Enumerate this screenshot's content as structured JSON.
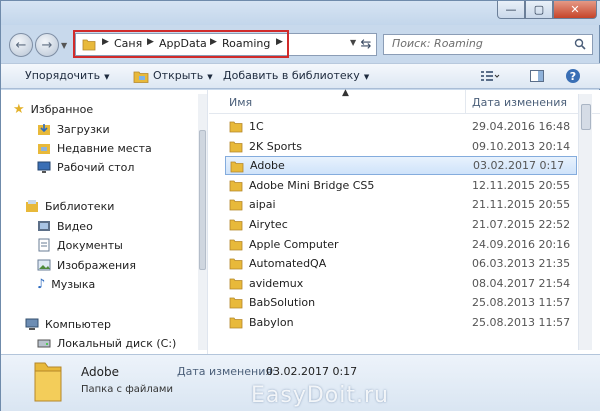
{
  "window": {
    "caption": {
      "minimize_glyph": "—",
      "maximize_glyph": "▢",
      "close_glyph": "✕"
    }
  },
  "address": {
    "crumbs": [
      "Саня",
      "AppData",
      "Roaming"
    ],
    "search_placeholder": "Поиск: Roaming"
  },
  "toolbar": {
    "organize": "Упорядочить",
    "open": "Открыть",
    "add_library": "Добавить в библиотеку"
  },
  "navigation": {
    "favorites": "Избранное",
    "downloads": "Загрузки",
    "recent": "Недавние места",
    "desktop": "Рабочий стол",
    "libraries": "Библиотеки",
    "video": "Видео",
    "documents": "Документы",
    "pictures": "Изображения",
    "music": "Музыка",
    "computer": "Компьютер",
    "local_disk": "Локальный диск (C:)"
  },
  "columns": {
    "name": "Имя",
    "date": "Дата изменения"
  },
  "files": [
    {
      "name": "1C",
      "date": "29.04.2016 16:48"
    },
    {
      "name": "2K Sports",
      "date": "09.10.2013 20:14"
    },
    {
      "name": "Adobe",
      "date": "03.02.2017 0:17"
    },
    {
      "name": "Adobe Mini Bridge CS5",
      "date": "12.11.2015 20:55"
    },
    {
      "name": "aipai",
      "date": "21.11.2015 20:55"
    },
    {
      "name": "Airytec",
      "date": "21.07.2015 22:52"
    },
    {
      "name": "Apple Computer",
      "date": "24.09.2016 20:16"
    },
    {
      "name": "AutomatedQA",
      "date": "06.03.2013 21:35"
    },
    {
      "name": "avidemux",
      "date": "08.04.2017 21:54"
    },
    {
      "name": "BabSolution",
      "date": "25.08.2013 11:57"
    },
    {
      "name": "Babylon",
      "date": "25.08.2013 11:57"
    }
  ],
  "selected_index": 2,
  "details": {
    "name": "Adobe",
    "type": "Папка с файлами",
    "date_label": "Дата изменения:",
    "date_value": "03.02.2017 0:17",
    "watermark": "EasyDoit.ru"
  },
  "colors": {
    "folder": "#e8b93a",
    "selection_border": "#84acdd",
    "highlight": "#d12a2a"
  }
}
